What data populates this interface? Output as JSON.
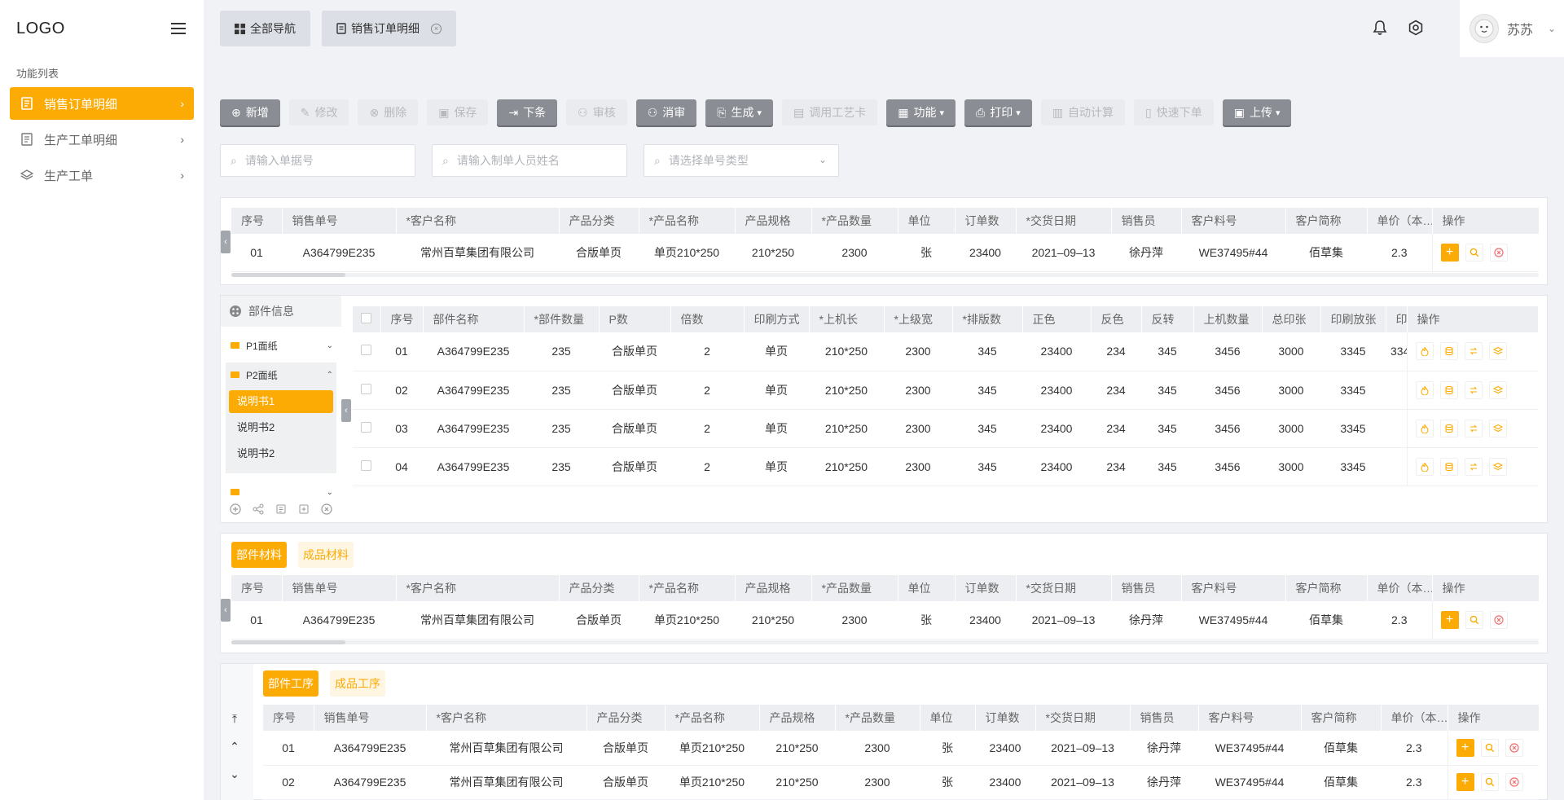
{
  "sidebar": {
    "logo": "LOGO",
    "section_title": "功能列表",
    "items": [
      {
        "label": "销售订单明细",
        "active": true
      },
      {
        "label": "生产工单明细",
        "active": false
      },
      {
        "label": "生产工单",
        "active": false
      }
    ]
  },
  "topbar": {
    "tabs": [
      {
        "label": "全部导航"
      },
      {
        "label": "销售订单明细"
      }
    ],
    "user": {
      "name": "苏苏"
    }
  },
  "toolbar": {
    "buttons": [
      {
        "label": "新增",
        "enabled": true
      },
      {
        "label": "修改",
        "enabled": false
      },
      {
        "label": "删除",
        "enabled": false
      },
      {
        "label": "保存",
        "enabled": false
      },
      {
        "label": "下条",
        "enabled": true
      },
      {
        "label": "审核",
        "enabled": false
      },
      {
        "label": "消审",
        "enabled": true
      },
      {
        "label": "生成",
        "enabled": true
      },
      {
        "label": "调用工艺卡",
        "enabled": false
      },
      {
        "label": "功能",
        "enabled": true
      },
      {
        "label": "打印",
        "enabled": true
      },
      {
        "label": "自动计算",
        "enabled": false
      },
      {
        "label": "快速下单",
        "enabled": false
      },
      {
        "label": "上传",
        "enabled": true
      }
    ]
  },
  "search": {
    "order_no_placeholder": "请输入单据号",
    "creator_placeholder": "请输入制单人员姓名",
    "order_type_placeholder": "请选择单号类型"
  },
  "orders_table": {
    "headers": [
      "序号",
      "销售单号",
      "*客户名称",
      "产品分类",
      "*产品名称",
      "产品规格",
      "*产品数量",
      "单位",
      "订单数",
      "*交货日期",
      "销售员",
      "客户料号",
      "客户简称",
      "单价（本…",
      "操作"
    ],
    "rows": [
      [
        "01",
        "A364799E235",
        "常州百草集团有限公司",
        "合版单页",
        "单页210*250",
        "210*250",
        "2300",
        "张",
        "23400",
        "2021–09–13",
        "徐丹萍",
        "WE37495#44",
        "佰草集",
        "2.3"
      ]
    ]
  },
  "parts_tree": {
    "title": "部件信息",
    "nodes": [
      {
        "label": "P1面纸",
        "expanded": false
      },
      {
        "label": "P2面纸",
        "expanded": true,
        "children": [
          "说明书1",
          "说明书2",
          "说明书2"
        ]
      },
      {
        "label": "",
        "expanded": false
      }
    ]
  },
  "parts_table": {
    "headers": [
      "序号",
      "部件名称",
      "*部件数量",
      "P数",
      "倍数",
      "印刷方式",
      "*上机长",
      "*上级宽",
      "*排版数",
      "正色",
      "反色",
      "反转",
      "上机数量",
      "总印张",
      "印刷放张",
      "印刷",
      "操作"
    ],
    "rows": [
      [
        "01",
        "A364799E235",
        "235",
        "合版单页",
        "2",
        "单页",
        "210*250",
        "2300",
        "345",
        "23400",
        "234",
        "345",
        "3456",
        "3000",
        "3345",
        "334"
      ],
      [
        "02",
        "A364799E235",
        "235",
        "合版单页",
        "2",
        "单页",
        "210*250",
        "2300",
        "345",
        "23400",
        "234",
        "345",
        "3456",
        "3000",
        "3345",
        ""
      ],
      [
        "03",
        "A364799E235",
        "235",
        "合版单页",
        "2",
        "单页",
        "210*250",
        "2300",
        "345",
        "23400",
        "234",
        "345",
        "3456",
        "3000",
        "3345",
        ""
      ],
      [
        "04",
        "A364799E235",
        "235",
        "合版单页",
        "2",
        "单页",
        "210*250",
        "2300",
        "345",
        "23400",
        "234",
        "345",
        "3456",
        "3000",
        "3345",
        ""
      ]
    ]
  },
  "materials": {
    "tabs": [
      "部件材料",
      "成品材料"
    ],
    "headers": [
      "序号",
      "销售单号",
      "*客户名称",
      "产品分类",
      "*产品名称",
      "产品规格",
      "*产品数量",
      "单位",
      "订单数",
      "*交货日期",
      "销售员",
      "客户料号",
      "客户简称",
      "单价（本…",
      "操作"
    ],
    "rows": [
      [
        "01",
        "A364799E235",
        "常州百草集团有限公司",
        "合版单页",
        "单页210*250",
        "210*250",
        "2300",
        "张",
        "23400",
        "2021–09–13",
        "徐丹萍",
        "WE37495#44",
        "佰草集",
        "2.3"
      ]
    ]
  },
  "processes": {
    "tabs": [
      "部件工序",
      "成品工序"
    ],
    "headers": [
      "序号",
      "销售单号",
      "*客户名称",
      "产品分类",
      "*产品名称",
      "产品规格",
      "*产品数量",
      "单位",
      "订单数",
      "*交货日期",
      "销售员",
      "客户料号",
      "客户简称",
      "单价（本…",
      "操作"
    ],
    "rows": [
      [
        "01",
        "A364799E235",
        "常州百草集团有限公司",
        "合版单页",
        "单页210*250",
        "210*250",
        "2300",
        "张",
        "23400",
        "2021–09–13",
        "徐丹萍",
        "WE37495#44",
        "佰草集",
        "2.3"
      ],
      [
        "02",
        "A364799E235",
        "常州百草集团有限公司",
        "合版单页",
        "单页210*250",
        "210*250",
        "2300",
        "张",
        "23400",
        "2021–09–13",
        "徐丹萍",
        "WE37495#44",
        "佰草集",
        "2.3"
      ]
    ]
  },
  "colors": {
    "accent": "#fcab05",
    "button_gray": "#8a8d94",
    "sidebar_bg": "#ffffff",
    "page_bg": "#f0f2f5"
  }
}
